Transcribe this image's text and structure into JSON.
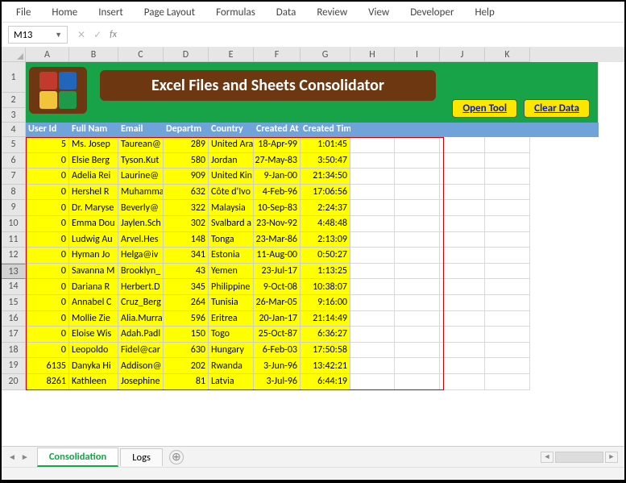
{
  "ribbon": [
    "File",
    "Home",
    "Insert",
    "Page Layout",
    "Formulas",
    "Data",
    "Review",
    "View",
    "Developer",
    "Help"
  ],
  "namebox": "M13",
  "columns": [
    "A",
    "B",
    "C",
    "D",
    "E",
    "F",
    "G",
    "H",
    "I",
    "J",
    "K"
  ],
  "col_widths": [
    "colA",
    "colB",
    "colC",
    "colD",
    "colE",
    "colF",
    "colG",
    "colH",
    "colI",
    "colJ",
    "colK"
  ],
  "title": "Excel Files and Sheets Consolidator",
  "buttons": {
    "open": "Open Tool",
    "clear": "Clear Data"
  },
  "headers": [
    "User Id",
    "Full Nam",
    "Email",
    "Departm",
    "Country",
    "Created At",
    "Created Time"
  ],
  "selected_row": 13,
  "rows": [
    {
      "n": 5,
      "id": "5",
      "name": "Ms. Josep",
      "email": "Taurean@",
      "dept": "289",
      "country": "United Ara",
      "date": "18-Apr-99",
      "time": "1:01:45"
    },
    {
      "n": 6,
      "id": "0",
      "name": "Elsie Berg",
      "email": "Tyson.Kut",
      "dept": "580",
      "country": "Jordan",
      "date": "27-May-83",
      "time": "3:50:47"
    },
    {
      "n": 7,
      "id": "0",
      "name": "Adelia Rei",
      "email": "Laurine@",
      "dept": "909",
      "country": "United Kin",
      "date": "9-Jan-00",
      "time": "21:34:50"
    },
    {
      "n": 8,
      "id": "0",
      "name": "Hershel R",
      "email": "Muhamma",
      "dept": "632",
      "country": "Côte d'Ivo",
      "date": "4-Feb-96",
      "time": "17:06:56"
    },
    {
      "n": 9,
      "id": "0",
      "name": "Dr. Maryse",
      "email": "Beverly@",
      "dept": "322",
      "country": "Malaysia",
      "date": "10-Sep-83",
      "time": "2:24:37"
    },
    {
      "n": 10,
      "id": "0",
      "name": "Emma Dou",
      "email": "Jaylen.Sch",
      "dept": "302",
      "country": "Svalbard a",
      "date": "23-Nov-92",
      "time": "4:48:48"
    },
    {
      "n": 11,
      "id": "0",
      "name": "Ludwig Au",
      "email": "Arvel.Hes",
      "dept": "148",
      "country": "Tonga",
      "date": "23-Mar-86",
      "time": "2:13:09"
    },
    {
      "n": 12,
      "id": "0",
      "name": "Hyman Jo",
      "email": "Helga@iv",
      "dept": "341",
      "country": "Estonia",
      "date": "11-Aug-00",
      "time": "0:50:27"
    },
    {
      "n": 13,
      "id": "0",
      "name": "Savanna M",
      "email": "Brooklyn_",
      "dept": "43",
      "country": "Yemen",
      "date": "23-Jul-17",
      "time": "1:13:25"
    },
    {
      "n": 14,
      "id": "0",
      "name": "Dariana R",
      "email": "Herbert.D",
      "dept": "345",
      "country": "Philippine",
      "date": "9-Oct-08",
      "time": "10:38:07"
    },
    {
      "n": 15,
      "id": "0",
      "name": "Annabel C",
      "email": "Cruz_Berg",
      "dept": "264",
      "country": "Tunisia",
      "date": "26-Mar-05",
      "time": "9:16:00"
    },
    {
      "n": 16,
      "id": "0",
      "name": "Mollie Zie",
      "email": "Alia.Murra",
      "dept": "596",
      "country": "Eritrea",
      "date": "20-Jan-17",
      "time": "21:14:49"
    },
    {
      "n": 17,
      "id": "0",
      "name": "Eloise Wis",
      "email": "Adah.Padl",
      "dept": "150",
      "country": "Togo",
      "date": "25-Oct-87",
      "time": "6:36:27"
    },
    {
      "n": 18,
      "id": "0",
      "name": "Leopoldo",
      "email": "Fidel@car",
      "dept": "630",
      "country": "Hungary",
      "date": "6-Feb-03",
      "time": "17:50:58"
    },
    {
      "n": 19,
      "id": "6135",
      "name": "Danyka Hi",
      "email": "Addison@",
      "dept": "202",
      "country": "Rwanda",
      "date": "3-Jun-96",
      "time": "13:42:21"
    },
    {
      "n": 20,
      "id": "8261",
      "name": "Kathleen",
      "email": "Josephine",
      "dept": "81",
      "country": "Latvia",
      "date": "3-Jul-96",
      "time": "6:44:19"
    }
  ],
  "sheets": {
    "active": "Consolidation",
    "other": "Logs"
  }
}
